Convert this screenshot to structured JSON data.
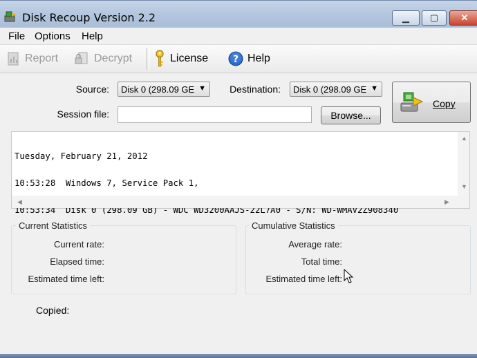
{
  "window": {
    "title": "Disk Recoup Version 2.2",
    "controls": {
      "minimize": "▁",
      "maximize": "▢",
      "close": "✕"
    }
  },
  "menu": {
    "items": [
      "File",
      "Options",
      "Help"
    ]
  },
  "toolbar": {
    "report": "Report",
    "decrypt": "Decrypt",
    "license": "License",
    "help": "Help"
  },
  "form": {
    "source_label": "Source:",
    "source_value": "Disk 0 (298.09 GE",
    "destination_label": "Destination:",
    "destination_value": "Disk 0 (298.09 GE",
    "session_label": "Session file:",
    "session_value": "",
    "browse_label": "Browse...",
    "copy_label": "Copy"
  },
  "log": {
    "lines": [
      "Tuesday, February 21, 2012",
      "10:53:28  Windows 7, Service Pack 1,",
      "10:53:34  Disk 0 (298.09 GB) - WDC WD3200AAJS-22L7A0 - S/N: WD-WMAV2Z908340"
    ]
  },
  "current_stats": {
    "title": "Current Statistics",
    "rate_label": "Current rate:",
    "elapsed_label": "Elapsed time:",
    "est_label": "Estimated time left:"
  },
  "cumulative_stats": {
    "title": "Cumulative Statistics",
    "avg_label": "Average rate:",
    "total_label": "Total time:",
    "est_label": "Estimated time left:"
  },
  "copied_label": "Copied:"
}
